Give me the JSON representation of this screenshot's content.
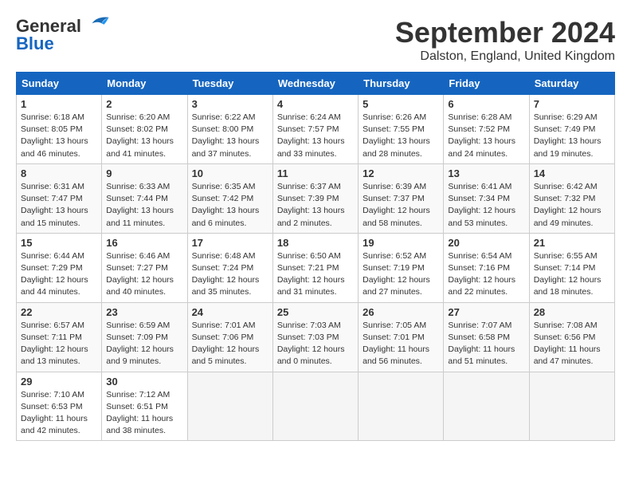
{
  "header": {
    "logo_line1": "General",
    "logo_line2": "Blue",
    "month": "September 2024",
    "location": "Dalston, England, United Kingdom"
  },
  "weekdays": [
    "Sunday",
    "Monday",
    "Tuesday",
    "Wednesday",
    "Thursday",
    "Friday",
    "Saturday"
  ],
  "weeks": [
    [
      {
        "day": "1",
        "sunrise": "Sunrise: 6:18 AM",
        "sunset": "Sunset: 8:05 PM",
        "daylight": "Daylight: 13 hours and 46 minutes."
      },
      {
        "day": "2",
        "sunrise": "Sunrise: 6:20 AM",
        "sunset": "Sunset: 8:02 PM",
        "daylight": "Daylight: 13 hours and 41 minutes."
      },
      {
        "day": "3",
        "sunrise": "Sunrise: 6:22 AM",
        "sunset": "Sunset: 8:00 PM",
        "daylight": "Daylight: 13 hours and 37 minutes."
      },
      {
        "day": "4",
        "sunrise": "Sunrise: 6:24 AM",
        "sunset": "Sunset: 7:57 PM",
        "daylight": "Daylight: 13 hours and 33 minutes."
      },
      {
        "day": "5",
        "sunrise": "Sunrise: 6:26 AM",
        "sunset": "Sunset: 7:55 PM",
        "daylight": "Daylight: 13 hours and 28 minutes."
      },
      {
        "day": "6",
        "sunrise": "Sunrise: 6:28 AM",
        "sunset": "Sunset: 7:52 PM",
        "daylight": "Daylight: 13 hours and 24 minutes."
      },
      {
        "day": "7",
        "sunrise": "Sunrise: 6:29 AM",
        "sunset": "Sunset: 7:49 PM",
        "daylight": "Daylight: 13 hours and 19 minutes."
      }
    ],
    [
      {
        "day": "8",
        "sunrise": "Sunrise: 6:31 AM",
        "sunset": "Sunset: 7:47 PM",
        "daylight": "Daylight: 13 hours and 15 minutes."
      },
      {
        "day": "9",
        "sunrise": "Sunrise: 6:33 AM",
        "sunset": "Sunset: 7:44 PM",
        "daylight": "Daylight: 13 hours and 11 minutes."
      },
      {
        "day": "10",
        "sunrise": "Sunrise: 6:35 AM",
        "sunset": "Sunset: 7:42 PM",
        "daylight": "Daylight: 13 hours and 6 minutes."
      },
      {
        "day": "11",
        "sunrise": "Sunrise: 6:37 AM",
        "sunset": "Sunset: 7:39 PM",
        "daylight": "Daylight: 13 hours and 2 minutes."
      },
      {
        "day": "12",
        "sunrise": "Sunrise: 6:39 AM",
        "sunset": "Sunset: 7:37 PM",
        "daylight": "Daylight: 12 hours and 58 minutes."
      },
      {
        "day": "13",
        "sunrise": "Sunrise: 6:41 AM",
        "sunset": "Sunset: 7:34 PM",
        "daylight": "Daylight: 12 hours and 53 minutes."
      },
      {
        "day": "14",
        "sunrise": "Sunrise: 6:42 AM",
        "sunset": "Sunset: 7:32 PM",
        "daylight": "Daylight: 12 hours and 49 minutes."
      }
    ],
    [
      {
        "day": "15",
        "sunrise": "Sunrise: 6:44 AM",
        "sunset": "Sunset: 7:29 PM",
        "daylight": "Daylight: 12 hours and 44 minutes."
      },
      {
        "day": "16",
        "sunrise": "Sunrise: 6:46 AM",
        "sunset": "Sunset: 7:27 PM",
        "daylight": "Daylight: 12 hours and 40 minutes."
      },
      {
        "day": "17",
        "sunrise": "Sunrise: 6:48 AM",
        "sunset": "Sunset: 7:24 PM",
        "daylight": "Daylight: 12 hours and 35 minutes."
      },
      {
        "day": "18",
        "sunrise": "Sunrise: 6:50 AM",
        "sunset": "Sunset: 7:21 PM",
        "daylight": "Daylight: 12 hours and 31 minutes."
      },
      {
        "day": "19",
        "sunrise": "Sunrise: 6:52 AM",
        "sunset": "Sunset: 7:19 PM",
        "daylight": "Daylight: 12 hours and 27 minutes."
      },
      {
        "day": "20",
        "sunrise": "Sunrise: 6:54 AM",
        "sunset": "Sunset: 7:16 PM",
        "daylight": "Daylight: 12 hours and 22 minutes."
      },
      {
        "day": "21",
        "sunrise": "Sunrise: 6:55 AM",
        "sunset": "Sunset: 7:14 PM",
        "daylight": "Daylight: 12 hours and 18 minutes."
      }
    ],
    [
      {
        "day": "22",
        "sunrise": "Sunrise: 6:57 AM",
        "sunset": "Sunset: 7:11 PM",
        "daylight": "Daylight: 12 hours and 13 minutes."
      },
      {
        "day": "23",
        "sunrise": "Sunrise: 6:59 AM",
        "sunset": "Sunset: 7:09 PM",
        "daylight": "Daylight: 12 hours and 9 minutes."
      },
      {
        "day": "24",
        "sunrise": "Sunrise: 7:01 AM",
        "sunset": "Sunset: 7:06 PM",
        "daylight": "Daylight: 12 hours and 5 minutes."
      },
      {
        "day": "25",
        "sunrise": "Sunrise: 7:03 AM",
        "sunset": "Sunset: 7:03 PM",
        "daylight": "Daylight: 12 hours and 0 minutes."
      },
      {
        "day": "26",
        "sunrise": "Sunrise: 7:05 AM",
        "sunset": "Sunset: 7:01 PM",
        "daylight": "Daylight: 11 hours and 56 minutes."
      },
      {
        "day": "27",
        "sunrise": "Sunrise: 7:07 AM",
        "sunset": "Sunset: 6:58 PM",
        "daylight": "Daylight: 11 hours and 51 minutes."
      },
      {
        "day": "28",
        "sunrise": "Sunrise: 7:08 AM",
        "sunset": "Sunset: 6:56 PM",
        "daylight": "Daylight: 11 hours and 47 minutes."
      }
    ],
    [
      {
        "day": "29",
        "sunrise": "Sunrise: 7:10 AM",
        "sunset": "Sunset: 6:53 PM",
        "daylight": "Daylight: 11 hours and 42 minutes."
      },
      {
        "day": "30",
        "sunrise": "Sunrise: 7:12 AM",
        "sunset": "Sunset: 6:51 PM",
        "daylight": "Daylight: 11 hours and 38 minutes."
      },
      null,
      null,
      null,
      null,
      null
    ]
  ]
}
